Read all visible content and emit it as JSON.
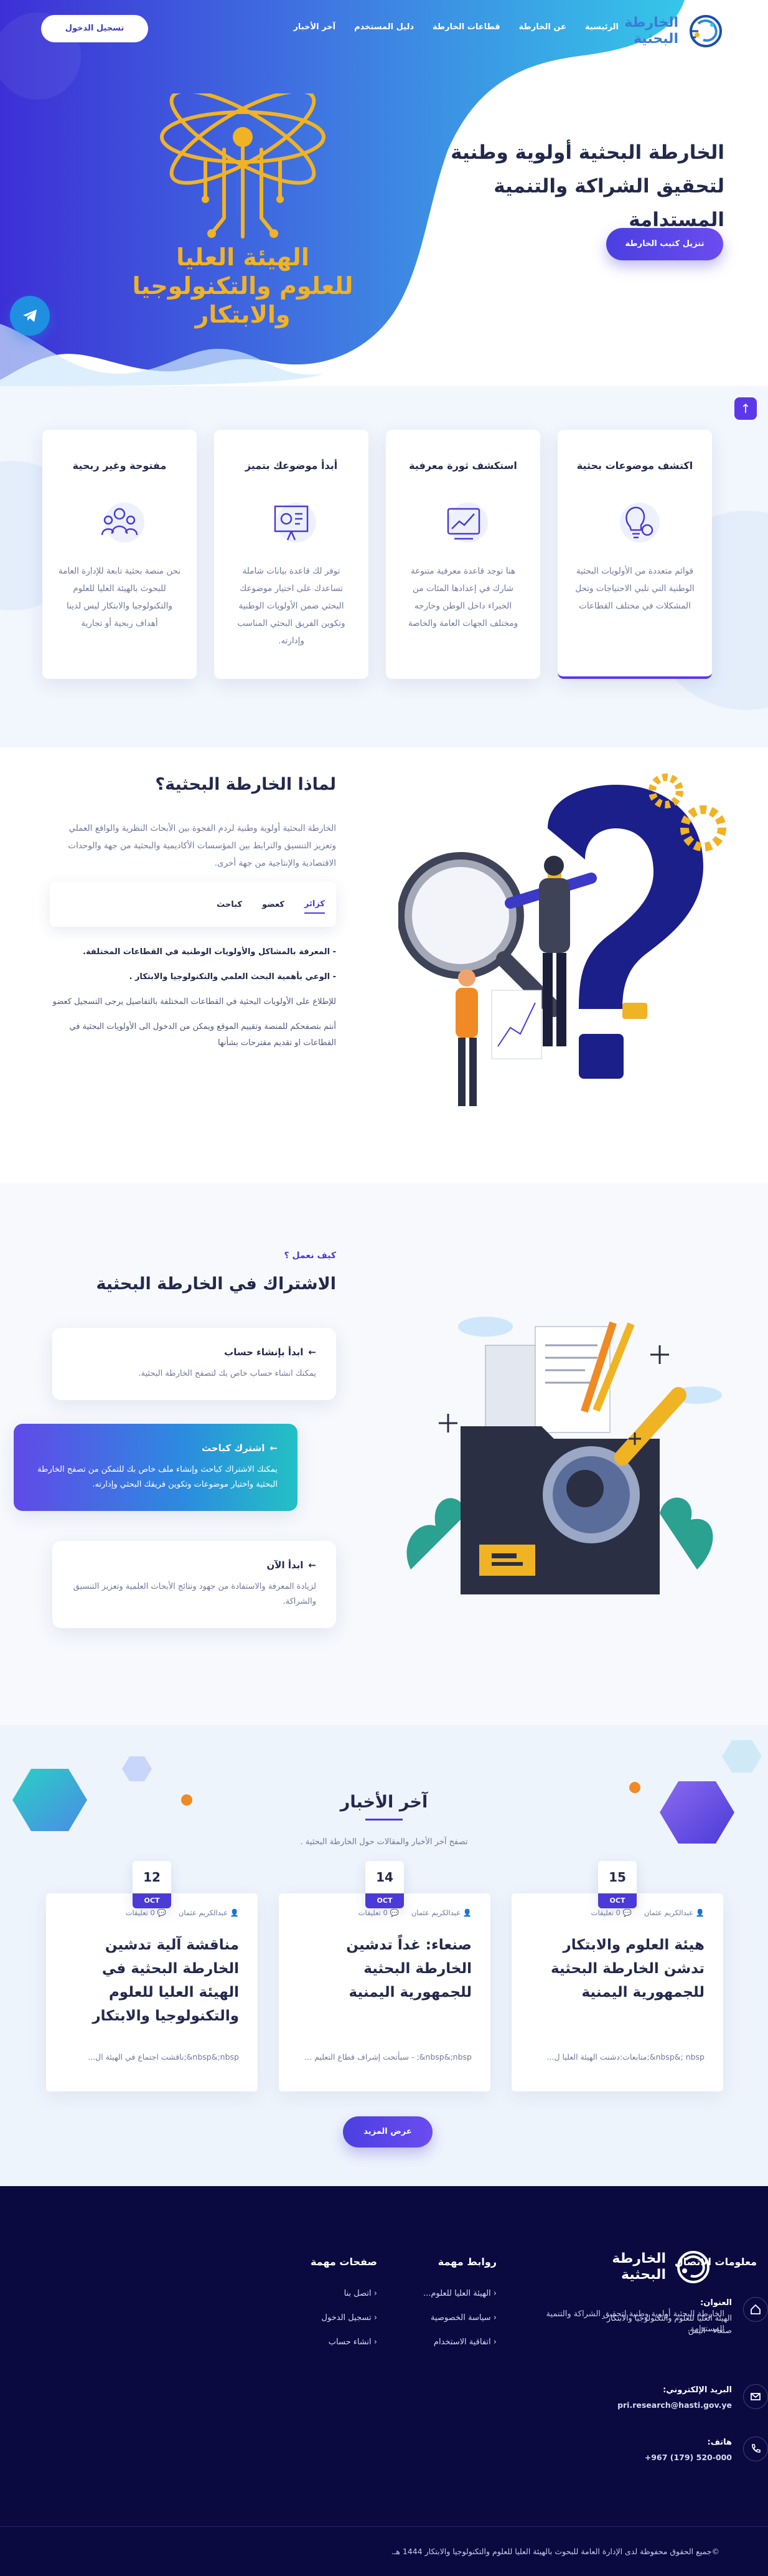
{
  "brand": {
    "name_line1": "الخارطة",
    "name_line2": "البحثية"
  },
  "nav": {
    "items": [
      "الرئيسية",
      "عن الخارطة",
      "قطاعات الخارطة",
      "دليل المستخدم",
      "آخر الأخبار"
    ],
    "login": "تسجيل الدخول"
  },
  "hero": {
    "title": "الخارطة البحثية أولوية وطنية لتحقيق الشراكة والتنمية المستدامة",
    "button": "تنزيل كتيب الخارطة",
    "org_line1": "الهيئة العليا",
    "org_line2": "للعلوم والتكنولوجيا",
    "org_line3": "والابتكار"
  },
  "features": [
    {
      "title": "اكتشف موضوعات بحثية",
      "text": "قوائم متعددة من الأولويات البحثية الوطنية التي تلبي الاحتياجات وتحل المشكلات في مختلف القطاعات",
      "icon": "lightbulb-gear-icon",
      "active": true
    },
    {
      "title": "استكشف ثورة معرفية",
      "text": "هنا توجد قاعدة معرفية متنوعة شارك في إعدادها المئات من الخبراء داخل الوطن وخارجه ومختلف الجهات العامة والخاصة",
      "icon": "growth-chart-icon",
      "active": false
    },
    {
      "title": "أبدأ موضوعك بتميز",
      "text": "توفر لك قاعدة بيانات شاملة تساعدك على اختيار موضوعك البحثي ضمن الأولويات الوطنية وتكوين الفريق البحثي المناسب وإدارته.",
      "icon": "presentation-board-icon",
      "active": false
    },
    {
      "title": "مفتوحة وغير ربحية",
      "text": "نحن منصة بحثية تابعة للإدارة العامة للبحوث بالهيئة العليا للعلوم والتكنولوجيا والابتكار ليس لدينا أهداف ربحية أو تجارية",
      "icon": "team-icon",
      "active": false
    }
  ],
  "why": {
    "title": "لماذا الخارطة البحثية؟",
    "description": "الخارطة البحثية أولوية وطنية لردم الفجوة بين الأبحاث النظرية والواقع العملي وتعزيز التنسيق والترابط بين المؤسسات الأكاديمية والبحثية من جهة والوحدات الاقتصادية والإنتاجية من جهة أخرى.",
    "tabs": [
      "كزائر",
      "كعضو",
      "كباحث"
    ],
    "points": [
      "- المعرفة بالمشاكل والأولويات الوطنية في القطاعات المختلفة.",
      "- الوعي بأهمية البحث العلمي والتكنولوجيا والابتكار .",
      "للإطلاع على الأولويات البحثية في القطاعات المختلفة بالتفاصيل يرجى التسجيل كعضو",
      "أنتم بتصفحكم للمنصة وتقييم الموقع ويمكن من الدخول الى الأولويات البحثية في القطاعات او تقديم مقترحات بشأنها"
    ]
  },
  "how": {
    "kicker": "كيف نعمل ؟",
    "title": "الاشتراك في الخارطة البحثية",
    "steps": [
      {
        "title": "ابدأ بإنشاء حساب",
        "text": "يمكنك انشاء حساب خاص بك لتصفح الخارطة البحثية."
      },
      {
        "title": "اشترك كباحث",
        "text": "يمكنك الاشتراك كباحث وإنشاء ملف خاص بك للتمكن من تصفح الخارطة البحثية واختيار موضوعات وتكوين فريقك البحثي وإدارته."
      },
      {
        "title": "ابدأ الآن",
        "text": "لزيادة المعرفة والاستفادة من جهود ونتائج الأبحاث العلمية وتعزيز التنسيق والشراكة."
      }
    ]
  },
  "news": {
    "title": "آخر الأخبار",
    "subtitle": "تصفح آخر الأخبار والمقالات حول الخارطة البحثية .",
    "items": [
      {
        "day": "15",
        "month": "OCT",
        "author": "عبدالكريم عثمان",
        "comments": "0 تعليقات",
        "title": "هيئة العلوم والابتكار تدشن الخارطة البحثية للجمهورية اليمنية",
        "excerpt": "nbsp&; nbsp&;متابعات:دشنت الهيئة العليا ل..."
      },
      {
        "day": "14",
        "month": "OCT",
        "author": "عبدالكريم عثمان",
        "comments": "0 تعليقات",
        "title": "صنعاء: غداً تدشين الخارطة البحثية للجمهورية اليمنية",
        "excerpt": "nbsp&;nbsp&; - سبأتحت إشراف قطاع التعليم ..."
      },
      {
        "day": "12",
        "month": "OCT",
        "author": "عبدالكريم عثمان",
        "comments": "0 تعليقات",
        "title": "مناقشة آلية تدشين الخارطة البحثية في الهيئة العليا للعلوم والتكنولوجيا والابتكار",
        "excerpt": "nbsp&;nbsp&;ناقشت اجتماع في الهيئة ال..."
      }
    ],
    "more": "عرض المزيد"
  },
  "footer": {
    "description": "الخارطة البحثية أولوية وطنية لتحقيق الشراكة والتنمية المستدامة.",
    "links_title": "روابط مهمة",
    "links": [
      "الهيئة العليا للعلوم...",
      "سياسة الخصوصية",
      "اتفاقية الاستخدام"
    ],
    "pages_title": "صفحات مهمة",
    "pages": [
      "اتصل بنا",
      "تسجيل الدخول",
      "انشاء حساب"
    ],
    "contact_title": "معلومات الاتصال",
    "address_label": "العنوان:",
    "address": "الهيئة العليا للعلوم والتكنولوجيا والابتكار - صنعاء - اليمن",
    "email_label": "البريد الإلكتروني:",
    "email": "pri.research@hasti.gov.ye",
    "phone_label": "هاتف:",
    "phone": "+967 (179) 520-000",
    "copyright": "©جميع الحقوق محفوظة لدى الإدارة العامة للبحوث بالهيئة العليا للعلوم والتكنولوجيا والابتكار 1444 هـ."
  },
  "colors": {
    "primary": "#4b39d8",
    "accent": "#f0b323",
    "footer_bg": "#0a0a40",
    "hero_blob": "#3f8be6"
  }
}
